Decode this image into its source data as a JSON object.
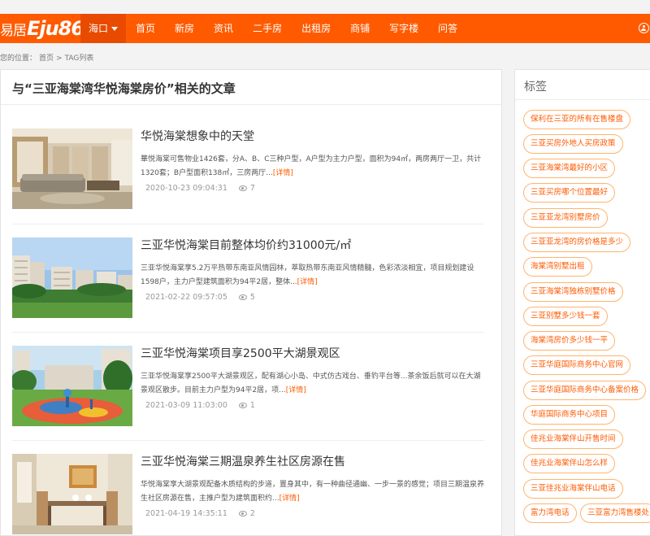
{
  "header": {
    "logo_cn": "易居",
    "logo_en": "Eju86",
    "nav": [
      {
        "label": "海口"
      },
      {
        "label": "首页"
      },
      {
        "label": "新房"
      },
      {
        "label": "资讯"
      },
      {
        "label": "二手房"
      },
      {
        "label": "出租房"
      },
      {
        "label": "商铺"
      },
      {
        "label": "写字楼"
      },
      {
        "label": "问答"
      }
    ]
  },
  "breadcrumb": {
    "prefix": "您的位置：",
    "home": "首页",
    "sep": ">",
    "current": "TAG列表"
  },
  "main": {
    "title": "与“三亚海棠湾华悦海棠房价”相关的文章",
    "articles": [
      {
        "title": "华悦海棠想象中的天堂",
        "desc": "華悦海棠可售物业1426套，分A、B、C三种户型，A户型为主力户型，面积为94㎡，两房两厅一卫，共计1320套；B户型面积138㎡，三房两厅...",
        "more": "[详情]",
        "date": "2020-10-23 09:04:31",
        "views": "7"
      },
      {
        "title": "三亚华悦海棠目前整体均价约31000元/㎡",
        "desc": "三亚华悦海棠享5.2万平热带东南亚风情园林，萃取热带东南亚风情精髓，色彩浓淡相宜，项目规划建设1598户，主力户型建筑面积为94平2居，整体...",
        "more": "[详情]",
        "date": "2021-02-22 09:57:05",
        "views": "5"
      },
      {
        "title": "三亚华悦海棠项目享2500平大湖景观区",
        "desc": "三亚华悦海棠享2500平大湖景观区，配有湖心小岛、中式仿古戏台、垂钓平台等...茶余饭后就可以在大湖景观区散步。目前主力户型为94平2居，项...",
        "more": "[详情]",
        "date": "2021-03-09 11:03:00",
        "views": "1"
      },
      {
        "title": "三亚华悦海棠三期温泉养生社区房源在售",
        "desc": "华悦海棠享大湖景观配备木质结构的步道，置身其中，有一种曲径通幽、一步一景的感觉；项目三期温泉养生社区房源在售，主推户型为建筑面积约...",
        "more": "[详情]",
        "date": "2021-04-19 14:35:11",
        "views": "2"
      }
    ]
  },
  "sidebar": {
    "title": "标签",
    "tags": [
      "保利在三亚的所有在售楼盘",
      "三亚买房外地人买房政策",
      "三亚海棠湾最好的小区",
      "三亚买房哪个位置最好",
      "三亚亚龙湾别墅房价",
      "三亚亚龙湾的房价格是多少",
      "海棠湾别墅出租",
      "三亚海棠湾独栋别墅价格",
      "三亚别墅多少钱一套",
      "海棠湾房价多少钱一平",
      "三亚华庭国际商务中心官网",
      "三亚华庭国际商务中心备案价格",
      "华庭国际商务中心项目",
      "佳兆业海棠伴山开售时间",
      "佳兆业海棠伴山怎么样",
      "三亚佳兆业海棠伴山电话",
      "富力湾电话",
      "三亚富力湾售楼处"
    ]
  },
  "colors": {
    "brand": "#ff5a00",
    "tag_border": "#ffb46e"
  }
}
